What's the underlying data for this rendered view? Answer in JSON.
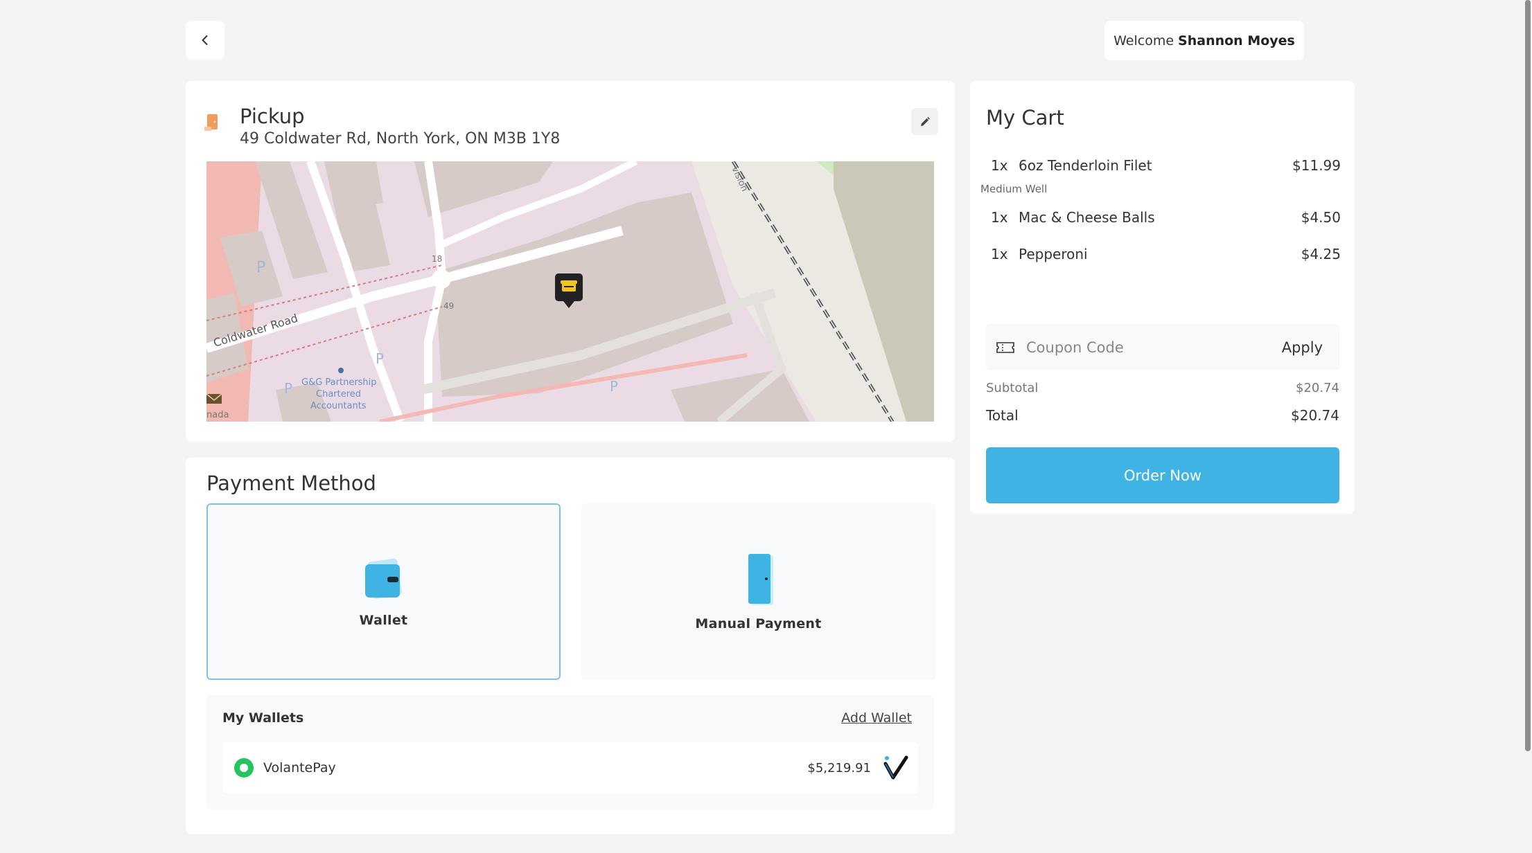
{
  "header": {
    "welcome_prefix": "Welcome",
    "user_name": "Shannon Moyes"
  },
  "pickup": {
    "title": "Pickup",
    "address": "49 Coldwater Rd, North York, ON M3B 1Y8",
    "map": {
      "street_label": "Coldwater Road",
      "poi_label_1": "G&G Partnership",
      "poi_label_2": "Chartered",
      "poi_label_3": "Accountants",
      "num_18": "18",
      "num_49": "49",
      "edge_label": "nada",
      "division_label": "vision",
      "parking": "P"
    }
  },
  "payment": {
    "title": "Payment Method",
    "options": [
      {
        "label": "Wallet",
        "selected": true
      },
      {
        "label": "Manual Payment",
        "selected": false
      }
    ],
    "wallets_title": "My Wallets",
    "add_wallet_label": "Add Wallet",
    "wallet": {
      "name": "VolantePay",
      "balance": "$5,219.91"
    }
  },
  "cart": {
    "title": "My Cart",
    "items": [
      {
        "qty": "1x",
        "name": "6oz Tenderloin Filet",
        "price": "$11.99",
        "note": "Medium Well"
      },
      {
        "qty": "1x",
        "name": "Mac & Cheese Balls",
        "price": "$4.50"
      },
      {
        "qty": "1x",
        "name": "Pepperoni",
        "price": "$4.25"
      }
    ],
    "coupon_placeholder": "Coupon Code",
    "apply_label": "Apply",
    "subtotal_label": "Subtotal",
    "subtotal_value": "$20.74",
    "total_label": "Total",
    "total_value": "$20.74",
    "order_button": "Order Now"
  },
  "colors": {
    "accent": "#3fb3e3",
    "selected_border": "#7fc3de",
    "radio_active": "#22c55e",
    "background": "#f3f4f6"
  }
}
